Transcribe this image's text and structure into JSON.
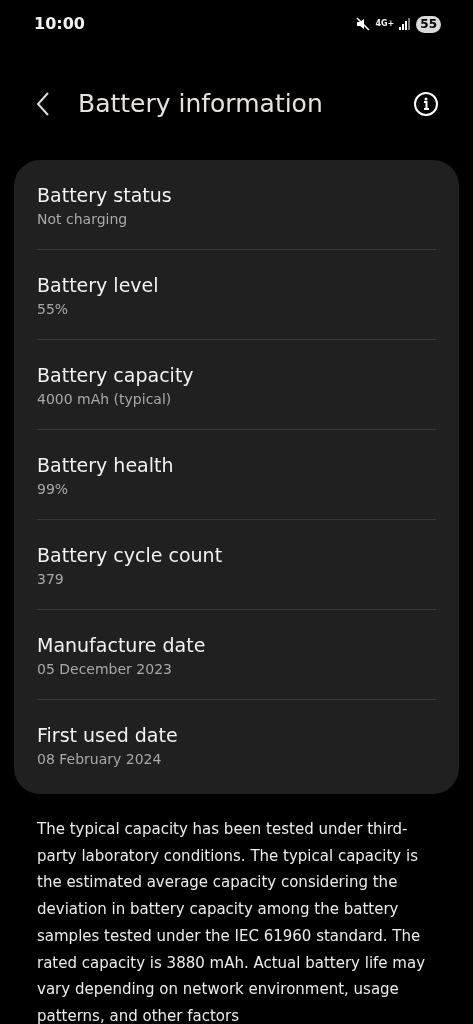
{
  "status_bar": {
    "time": "10:00",
    "network": "4G+",
    "battery": "55"
  },
  "header": {
    "title": "Battery information"
  },
  "items": [
    {
      "title": "Battery status",
      "value": "Not charging"
    },
    {
      "title": "Battery level",
      "value": "55%"
    },
    {
      "title": "Battery capacity",
      "value": "4000 mAh (typical)"
    },
    {
      "title": "Battery health",
      "value": "99%"
    },
    {
      "title": "Battery cycle count",
      "value": "379"
    },
    {
      "title": "Manufacture date",
      "value": "05 December 2023"
    },
    {
      "title": "First used date",
      "value": "08 February 2024"
    }
  ],
  "note": "The typical capacity has been tested under third-party laboratory conditions. The typical capacity is the estimated average capacity considering the deviation in battery capacity among the battery samples tested under the IEC 61960 standard. The rated capacity is 3880 mAh. Actual battery life may vary depending on network environment, usage patterns, and other factors"
}
